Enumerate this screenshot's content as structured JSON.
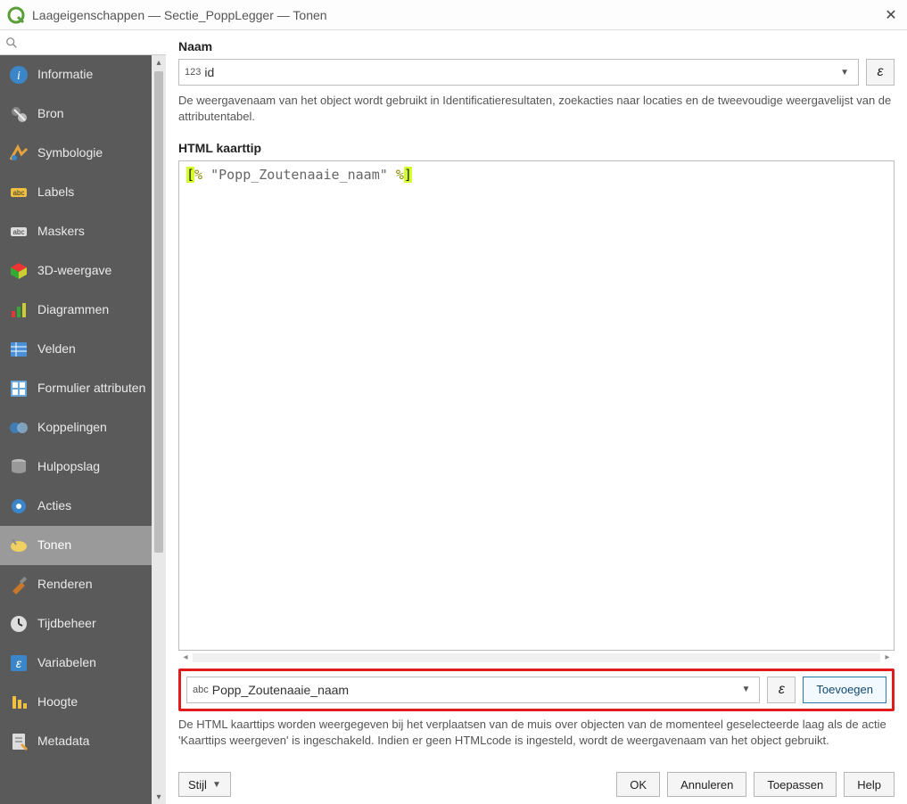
{
  "window": {
    "title": "Laageigenschappen — Sectie_PoppLegger — Tonen"
  },
  "sidebar": {
    "search_placeholder": "",
    "items": [
      {
        "id": "informatie",
        "label": "Informatie"
      },
      {
        "id": "bron",
        "label": "Bron"
      },
      {
        "id": "symbologie",
        "label": "Symbologie"
      },
      {
        "id": "labels",
        "label": "Labels"
      },
      {
        "id": "maskers",
        "label": "Maskers"
      },
      {
        "id": "3d",
        "label": "3D-weergave"
      },
      {
        "id": "diagrammen",
        "label": "Diagrammen"
      },
      {
        "id": "velden",
        "label": "Velden"
      },
      {
        "id": "formulier",
        "label": "Formulier attributen"
      },
      {
        "id": "koppelingen",
        "label": "Koppelingen"
      },
      {
        "id": "hulpopslag",
        "label": "Hulpopslag"
      },
      {
        "id": "acties",
        "label": "Acties"
      },
      {
        "id": "tonen",
        "label": "Tonen"
      },
      {
        "id": "renderen",
        "label": "Renderen"
      },
      {
        "id": "tijdbeheer",
        "label": "Tijdbeheer"
      },
      {
        "id": "variabelen",
        "label": "Variabelen"
      },
      {
        "id": "hoogte",
        "label": "Hoogte"
      },
      {
        "id": "metadata",
        "label": "Metadata"
      }
    ],
    "active": "tonen"
  },
  "main": {
    "naam": {
      "label": "Naam",
      "field_prefix": "123",
      "field_value": "id",
      "help": "De weergavenaam van het object wordt gebruikt in Identificatieresultaten, zoekacties naar locaties en de tweevoudige weergavelijst van de attributentabel."
    },
    "html_tip": {
      "label": "HTML kaarttip",
      "code_open": "[",
      "code_pct1": "%",
      "code_str": " \"Popp_Zoutenaaie_naam\" ",
      "code_pct2": "%",
      "code_close": "]"
    },
    "insert": {
      "field_prefix": "abc",
      "field_value": "Popp_Zoutenaaie_naam",
      "epsilon": "ε",
      "button": "Toevoegen"
    },
    "tip_help": "De HTML kaarttips worden weergegeven bij het verplaatsen van de muis over objecten van de momenteel geselecteerde laag als de actie 'Kaarttips weergeven' is ingeschakeld. Indien er geen HTMLcode is ingesteld, wordt de weergavenaam van het object gebruikt."
  },
  "footer": {
    "style": "Stijl",
    "ok": "OK",
    "cancel": "Annuleren",
    "apply": "Toepassen",
    "help": "Help"
  },
  "icons": {
    "epsilon": "ε"
  }
}
